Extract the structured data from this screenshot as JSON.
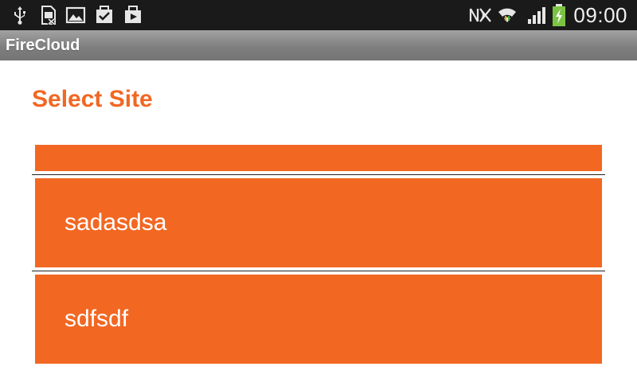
{
  "status_bar": {
    "time": "09:00",
    "left_icons": [
      "usb-icon",
      "sim-icon",
      "gallery-icon",
      "task-check-icon",
      "media-bag-icon"
    ],
    "right_icons": [
      "nfc-muted-icon",
      "wifi-icon",
      "signal-icon",
      "battery-charging-icon"
    ]
  },
  "app": {
    "title": "FireCloud"
  },
  "main": {
    "heading": "Select Site",
    "sites": [
      {
        "label": ""
      },
      {
        "label": "sadasdsa"
      },
      {
        "label": "sdfsdf"
      }
    ]
  },
  "colors": {
    "accent": "#f26722",
    "status_bar": "#1a1a1a",
    "title_bar": "#8a8a8a",
    "battery_green": "#7cc242"
  }
}
